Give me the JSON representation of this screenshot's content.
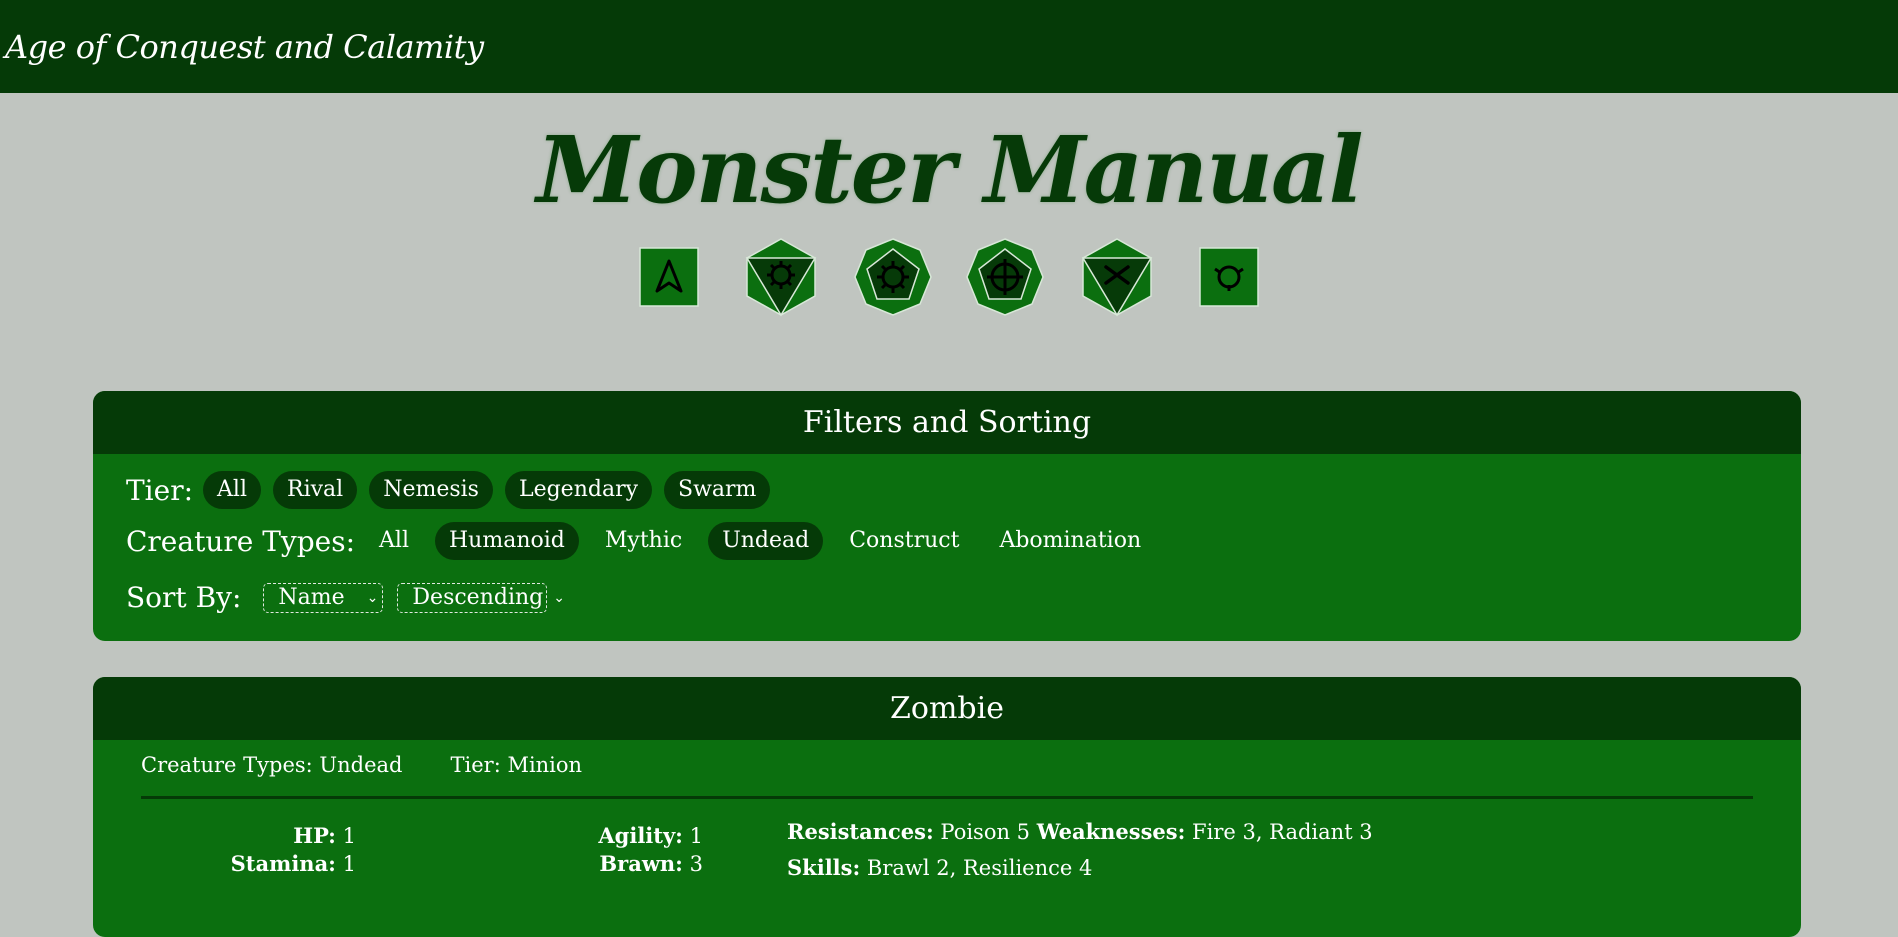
{
  "header": {
    "site_title": "Age of Conquest and Calamity"
  },
  "hero": {
    "title": "Monster Manual",
    "dice_icons": [
      "d4-icon",
      "d6-icon",
      "d8-icon",
      "d10-icon",
      "d12-icon",
      "d20-icon"
    ]
  },
  "filters": {
    "title": "Filters and Sorting",
    "tier_label": "Tier:",
    "tiers": [
      {
        "label": "All",
        "active": true
      },
      {
        "label": "Rival",
        "active": true
      },
      {
        "label": "Nemesis",
        "active": true
      },
      {
        "label": "Legendary",
        "active": true
      },
      {
        "label": "Swarm",
        "active": true
      }
    ],
    "types_label": "Creature Types:",
    "types": [
      {
        "label": "All",
        "active": false
      },
      {
        "label": "Humanoid",
        "active": true
      },
      {
        "label": "Mythic",
        "active": false
      },
      {
        "label": "Undead",
        "active": true
      },
      {
        "label": "Construct",
        "active": false
      },
      {
        "label": "Abomination",
        "active": false
      }
    ],
    "sort_label": "Sort By:",
    "sort_field": "Name",
    "sort_order": "Descending"
  },
  "monster": {
    "name": "Zombie",
    "creature_types": "Creature Types: Undead",
    "tier": "Tier: Minion",
    "hp_label": "HP:",
    "hp": "1",
    "stamina_label": "Stamina:",
    "stamina": "1",
    "agility_label": "Agility:",
    "agility": "1",
    "brawn_label": "Brawn:",
    "brawn": "3",
    "resistances_label": "Resistances:",
    "resistances": "Poison 5",
    "weaknesses_label": "Weaknesses:",
    "weaknesses": "Fire 3, Radiant 3",
    "skills_label": "Skills:",
    "skills": "Brawl 2, Resilience 4"
  },
  "colors": {
    "dark_green": "#053a07",
    "green": "#0b6f0f",
    "background": "#c0c5c0"
  }
}
